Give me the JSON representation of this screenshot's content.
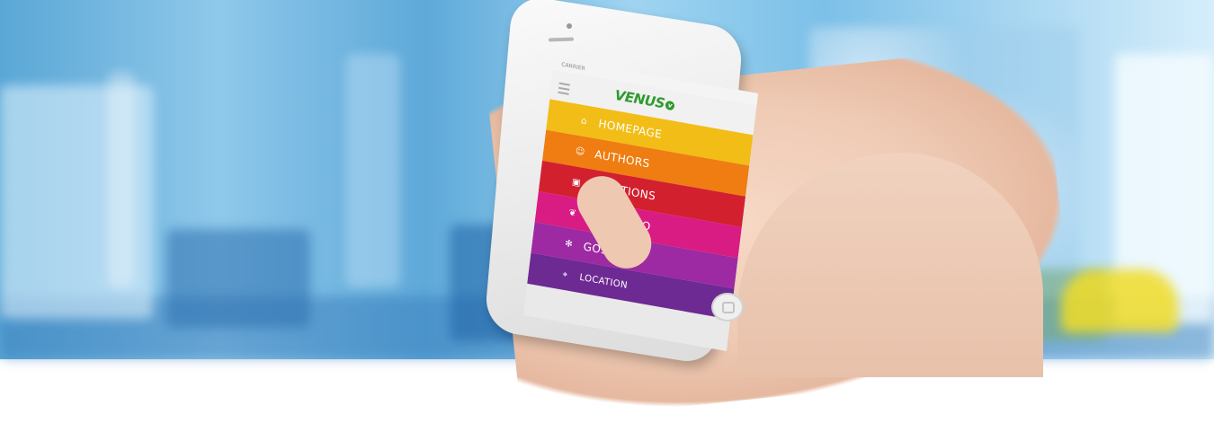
{
  "phone": {
    "status_text": "CARRIER",
    "logo_text": "VENUS",
    "logo_tag": "v",
    "menu": [
      {
        "label": "HOMEPAGE",
        "icon": "home-icon",
        "color": "#f2bd16"
      },
      {
        "label": "AUTHORS",
        "icon": "user-icon",
        "color": "#ef7d12"
      },
      {
        "label": "SOLUTIONS",
        "icon": "briefcase-icon",
        "color": "#d3202f"
      },
      {
        "label": "PORTFOLIO",
        "icon": "feather-icon",
        "color": "#d81c83"
      },
      {
        "label": "GOSSIPS",
        "icon": "sun-icon",
        "color": "#9d2aa2"
      },
      {
        "label": "LOCATION",
        "icon": "location-pin-icon",
        "color": "#6d2a93"
      }
    ]
  }
}
